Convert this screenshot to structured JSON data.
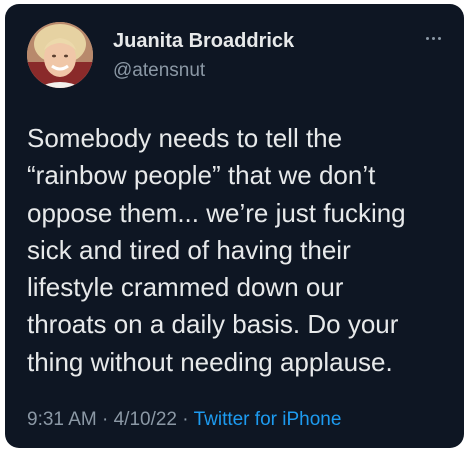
{
  "author": {
    "name": "Juanita Broaddrick",
    "handle": "@atensnut"
  },
  "header": {
    "more_icon": "more-horizontal-icon"
  },
  "tweet": {
    "lines": [
      "Somebody needs to tell the",
      "“rainbow people” that we don’t",
      "oppose them... we’re just fucking",
      "sick and tired of having their",
      "lifestyle crammed down our",
      "throats on a daily basis.  Do your",
      "thing without needing applause."
    ]
  },
  "meta": {
    "time": "9:31 AM",
    "separator": " · ",
    "date": "4/10/22",
    "source": "Twitter for iPhone"
  },
  "colors": {
    "background": "#0e1623",
    "text": "#e7e9ea",
    "secondary": "#8b98a5",
    "link": "#1d9bf0"
  }
}
